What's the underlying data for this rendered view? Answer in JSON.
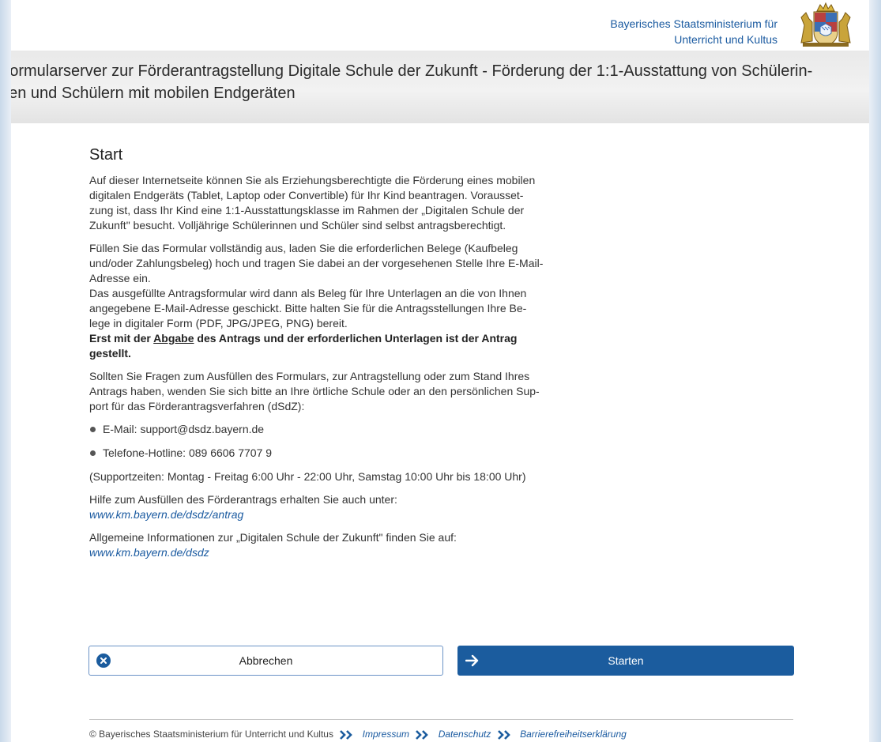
{
  "header": {
    "ministry_line1": "Bayerisches Staatsministerium für",
    "ministry_line2": "Unterricht und Kultus",
    "banner_line1": "Formularserver zur Förderantragstellung Digitale Schule der Zukunft - Förderung der 1:1-Ausstattung von Schülerin-",
    "banner_line2": "nen und Schülern mit mobilen Endgeräten"
  },
  "main": {
    "heading": "Start",
    "p1": [
      "Auf dieser Internetseite können Sie als Erziehungsberechtigte die Förderung eines mobilen",
      "digitalen Endgeräts (Tablet, Laptop oder Convertible) für Ihr Kind beantragen. Vorausset-",
      "zung ist, dass Ihr Kind eine 1:1-Ausstattungsklasse im Rahmen der „Digitalen Schule der",
      "Zukunft\" besucht. Volljährige Schülerinnen und Schüler sind selbst antragsberechtigt."
    ],
    "p2": [
      "Füllen Sie das Formular vollständig aus, laden Sie die erforderlichen Belege (Kaufbeleg",
      "und/oder Zahlungsbeleg) hoch und tragen Sie dabei an der vorgesehenen Stelle Ihre E-Mail-",
      "Adresse ein.",
      "Das ausgefüllte Antragsformular wird dann als Beleg für Ihre Unterlagen an die von Ihnen",
      "angegebene E-Mail-Adresse geschickt. Bitte halten Sie für die Antragsstellungen Ihre Be-",
      "lege in digitaler Form (PDF, JPG/JPEG, PNG) bereit."
    ],
    "bold_pre": "Erst mit der ",
    "bold_under": "Abgabe",
    "bold_post": " des Antrags und der erforderlichen Unterlagen ist der Antrag",
    "bold_line2": "gestellt.",
    "p3": [
      "Sollten Sie Fragen zum Ausfüllen des Formulars, zur Antragstellung oder zum Stand Ihres",
      "Antrags haben, wenden Sie sich bitte an Ihre örtliche Schule oder an den persönlichen Sup-",
      "port für das Förderantragsverfahren (dSdZ):"
    ],
    "contact_email": "E-Mail: support@dsdz.bayern.de",
    "contact_phone": "Telefone-Hotline: 089 6606 7707 9",
    "support_hours": "(Supportzeiten: Montag - Freitag 6:00 Uhr - 22:00 Uhr, Samstag 10:00 Uhr bis 18:00 Uhr)",
    "help_text": "Hilfe zum Ausfüllen des Förderantrags erhalten Sie auch unter:",
    "help_link": "www.km.bayern.de/dsdz/antrag",
    "info_text": "Allgemeine Informationen zur „Digitalen Schule der Zukunft\" finden Sie auf:",
    "info_link": "www.km.bayern.de/dsdz"
  },
  "buttons": {
    "cancel_label": "Abbrechen",
    "start_label": "Starten",
    "cancel_icon": "close-circle-icon",
    "start_icon": "arrow-right-icon"
  },
  "footer": {
    "copyright": "© Bayerisches Staatsministerium für Unterricht und Kultus",
    "impressum": "Impressum",
    "datenschutz": "Datenschutz",
    "barrierefreiheit": "Barrierefreiheitserklärung"
  },
  "colors": {
    "brand_blue": "#1b5c9e",
    "link_blue": "#1a5aa0"
  }
}
